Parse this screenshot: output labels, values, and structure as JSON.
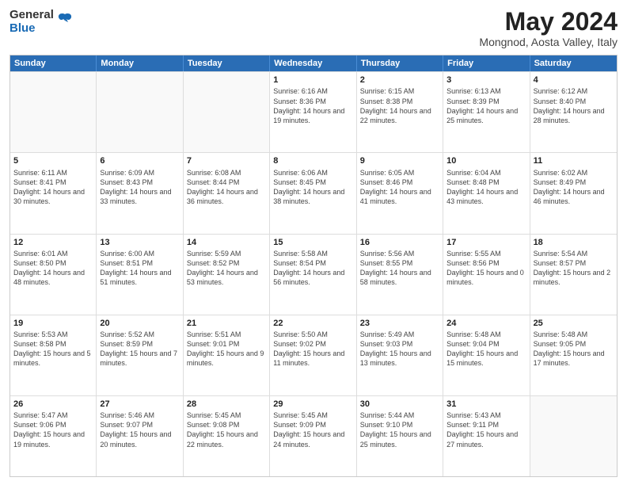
{
  "header": {
    "logo_general": "General",
    "logo_blue": "Blue",
    "month_title": "May 2024",
    "location": "Mongnod, Aosta Valley, Italy"
  },
  "days_of_week": [
    "Sunday",
    "Monday",
    "Tuesday",
    "Wednesday",
    "Thursday",
    "Friday",
    "Saturday"
  ],
  "weeks": [
    [
      {
        "day": "",
        "sunrise": "",
        "sunset": "",
        "daylight": "",
        "empty": true
      },
      {
        "day": "",
        "sunrise": "",
        "sunset": "",
        "daylight": "",
        "empty": true
      },
      {
        "day": "",
        "sunrise": "",
        "sunset": "",
        "daylight": "",
        "empty": true
      },
      {
        "day": "1",
        "sunrise": "Sunrise: 6:16 AM",
        "sunset": "Sunset: 8:36 PM",
        "daylight": "Daylight: 14 hours and 19 minutes."
      },
      {
        "day": "2",
        "sunrise": "Sunrise: 6:15 AM",
        "sunset": "Sunset: 8:38 PM",
        "daylight": "Daylight: 14 hours and 22 minutes."
      },
      {
        "day": "3",
        "sunrise": "Sunrise: 6:13 AM",
        "sunset": "Sunset: 8:39 PM",
        "daylight": "Daylight: 14 hours and 25 minutes."
      },
      {
        "day": "4",
        "sunrise": "Sunrise: 6:12 AM",
        "sunset": "Sunset: 8:40 PM",
        "daylight": "Daylight: 14 hours and 28 minutes."
      }
    ],
    [
      {
        "day": "5",
        "sunrise": "Sunrise: 6:11 AM",
        "sunset": "Sunset: 8:41 PM",
        "daylight": "Daylight: 14 hours and 30 minutes."
      },
      {
        "day": "6",
        "sunrise": "Sunrise: 6:09 AM",
        "sunset": "Sunset: 8:43 PM",
        "daylight": "Daylight: 14 hours and 33 minutes."
      },
      {
        "day": "7",
        "sunrise": "Sunrise: 6:08 AM",
        "sunset": "Sunset: 8:44 PM",
        "daylight": "Daylight: 14 hours and 36 minutes."
      },
      {
        "day": "8",
        "sunrise": "Sunrise: 6:06 AM",
        "sunset": "Sunset: 8:45 PM",
        "daylight": "Daylight: 14 hours and 38 minutes."
      },
      {
        "day": "9",
        "sunrise": "Sunrise: 6:05 AM",
        "sunset": "Sunset: 8:46 PM",
        "daylight": "Daylight: 14 hours and 41 minutes."
      },
      {
        "day": "10",
        "sunrise": "Sunrise: 6:04 AM",
        "sunset": "Sunset: 8:48 PM",
        "daylight": "Daylight: 14 hours and 43 minutes."
      },
      {
        "day": "11",
        "sunrise": "Sunrise: 6:02 AM",
        "sunset": "Sunset: 8:49 PM",
        "daylight": "Daylight: 14 hours and 46 minutes."
      }
    ],
    [
      {
        "day": "12",
        "sunrise": "Sunrise: 6:01 AM",
        "sunset": "Sunset: 8:50 PM",
        "daylight": "Daylight: 14 hours and 48 minutes."
      },
      {
        "day": "13",
        "sunrise": "Sunrise: 6:00 AM",
        "sunset": "Sunset: 8:51 PM",
        "daylight": "Daylight: 14 hours and 51 minutes."
      },
      {
        "day": "14",
        "sunrise": "Sunrise: 5:59 AM",
        "sunset": "Sunset: 8:52 PM",
        "daylight": "Daylight: 14 hours and 53 minutes."
      },
      {
        "day": "15",
        "sunrise": "Sunrise: 5:58 AM",
        "sunset": "Sunset: 8:54 PM",
        "daylight": "Daylight: 14 hours and 56 minutes."
      },
      {
        "day": "16",
        "sunrise": "Sunrise: 5:56 AM",
        "sunset": "Sunset: 8:55 PM",
        "daylight": "Daylight: 14 hours and 58 minutes."
      },
      {
        "day": "17",
        "sunrise": "Sunrise: 5:55 AM",
        "sunset": "Sunset: 8:56 PM",
        "daylight": "Daylight: 15 hours and 0 minutes."
      },
      {
        "day": "18",
        "sunrise": "Sunrise: 5:54 AM",
        "sunset": "Sunset: 8:57 PM",
        "daylight": "Daylight: 15 hours and 2 minutes."
      }
    ],
    [
      {
        "day": "19",
        "sunrise": "Sunrise: 5:53 AM",
        "sunset": "Sunset: 8:58 PM",
        "daylight": "Daylight: 15 hours and 5 minutes."
      },
      {
        "day": "20",
        "sunrise": "Sunrise: 5:52 AM",
        "sunset": "Sunset: 8:59 PM",
        "daylight": "Daylight: 15 hours and 7 minutes."
      },
      {
        "day": "21",
        "sunrise": "Sunrise: 5:51 AM",
        "sunset": "Sunset: 9:01 PM",
        "daylight": "Daylight: 15 hours and 9 minutes."
      },
      {
        "day": "22",
        "sunrise": "Sunrise: 5:50 AM",
        "sunset": "Sunset: 9:02 PM",
        "daylight": "Daylight: 15 hours and 11 minutes."
      },
      {
        "day": "23",
        "sunrise": "Sunrise: 5:49 AM",
        "sunset": "Sunset: 9:03 PM",
        "daylight": "Daylight: 15 hours and 13 minutes."
      },
      {
        "day": "24",
        "sunrise": "Sunrise: 5:48 AM",
        "sunset": "Sunset: 9:04 PM",
        "daylight": "Daylight: 15 hours and 15 minutes."
      },
      {
        "day": "25",
        "sunrise": "Sunrise: 5:48 AM",
        "sunset": "Sunset: 9:05 PM",
        "daylight": "Daylight: 15 hours and 17 minutes."
      }
    ],
    [
      {
        "day": "26",
        "sunrise": "Sunrise: 5:47 AM",
        "sunset": "Sunset: 9:06 PM",
        "daylight": "Daylight: 15 hours and 19 minutes."
      },
      {
        "day": "27",
        "sunrise": "Sunrise: 5:46 AM",
        "sunset": "Sunset: 9:07 PM",
        "daylight": "Daylight: 15 hours and 20 minutes."
      },
      {
        "day": "28",
        "sunrise": "Sunrise: 5:45 AM",
        "sunset": "Sunset: 9:08 PM",
        "daylight": "Daylight: 15 hours and 22 minutes."
      },
      {
        "day": "29",
        "sunrise": "Sunrise: 5:45 AM",
        "sunset": "Sunset: 9:09 PM",
        "daylight": "Daylight: 15 hours and 24 minutes."
      },
      {
        "day": "30",
        "sunrise": "Sunrise: 5:44 AM",
        "sunset": "Sunset: 9:10 PM",
        "daylight": "Daylight: 15 hours and 25 minutes."
      },
      {
        "day": "31",
        "sunrise": "Sunrise: 5:43 AM",
        "sunset": "Sunset: 9:11 PM",
        "daylight": "Daylight: 15 hours and 27 minutes."
      },
      {
        "day": "",
        "sunrise": "",
        "sunset": "",
        "daylight": "",
        "empty": true
      }
    ]
  ]
}
